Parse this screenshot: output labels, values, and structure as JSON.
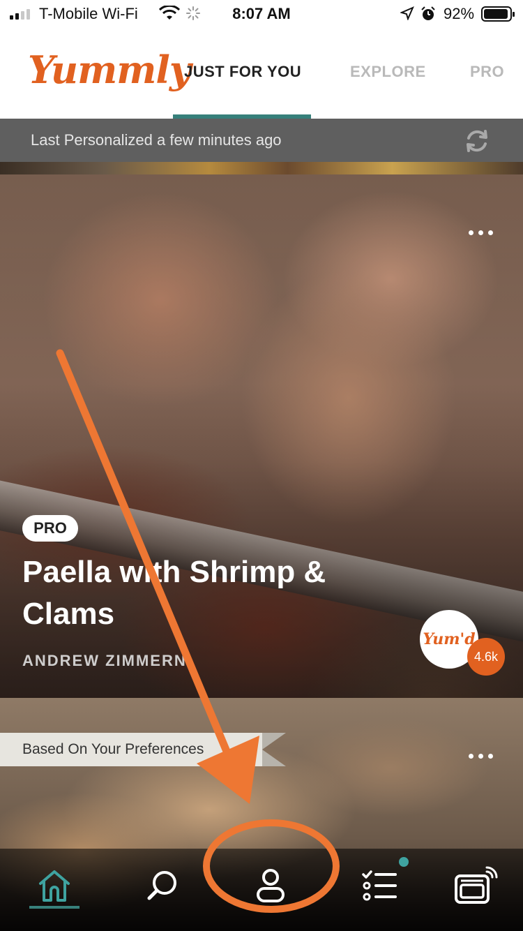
{
  "status_bar": {
    "carrier": "T-Mobile Wi-Fi",
    "time": "8:07 AM",
    "battery": "92%"
  },
  "header": {
    "logo": "Yummly",
    "tabs": [
      {
        "label": "JUST FOR YOU",
        "active": true
      },
      {
        "label": "EXPLORE",
        "active": false
      },
      {
        "label": "PRO",
        "active": false
      }
    ]
  },
  "personalized": {
    "label": "Last Personalized a few minutes ago"
  },
  "cards": [
    {
      "badge": "PRO",
      "title": "Paella with Shrimp & Clams",
      "author": "ANDREW ZIMMERN",
      "yumd_label": "Yum'd",
      "yum_count": "4.6k"
    },
    {
      "banner": "Based On Your Preferences"
    }
  ],
  "bottom_nav": {
    "items": [
      "home-icon",
      "search-icon",
      "profile-icon",
      "shopping-list-icon",
      "smart-oven-icon"
    ],
    "active": "home-icon",
    "highlighted": "profile-icon"
  },
  "colors": {
    "brand_orange": "#e16120",
    "accent_teal": "#37807b",
    "annotation_orange": "#ee7733"
  }
}
